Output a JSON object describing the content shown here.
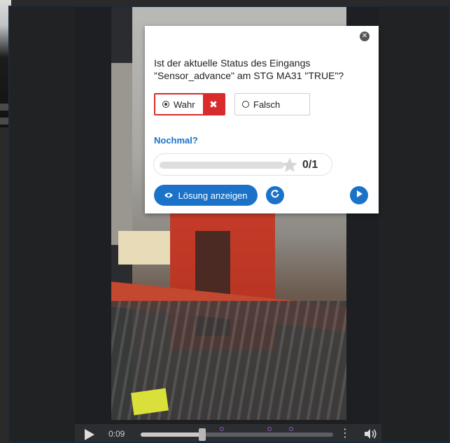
{
  "question": {
    "text": "Ist der aktuelle Status des Eingangs \"Sensor_advance\" am STG MA31 \"TRUE\"?"
  },
  "options": [
    {
      "label": "Wahr",
      "selected": true,
      "result": "wrong"
    },
    {
      "label": "Falsch",
      "selected": false
    }
  ],
  "feedback": {
    "retry_text": "Nochmal?"
  },
  "score": {
    "text": "0/1",
    "fraction": 0
  },
  "buttons": {
    "show_solution": "Lösung anzeigen",
    "close_icon": "close-icon",
    "retry_icon": "refresh-icon",
    "next_icon": "play-icon"
  },
  "player": {
    "time": "0:09",
    "progress_fraction": 0.32,
    "interaction_markers_fraction": [
      0.42,
      0.67,
      0.78
    ]
  },
  "colors": {
    "accent": "#1a73c9",
    "wrong": "#d92b2b"
  }
}
